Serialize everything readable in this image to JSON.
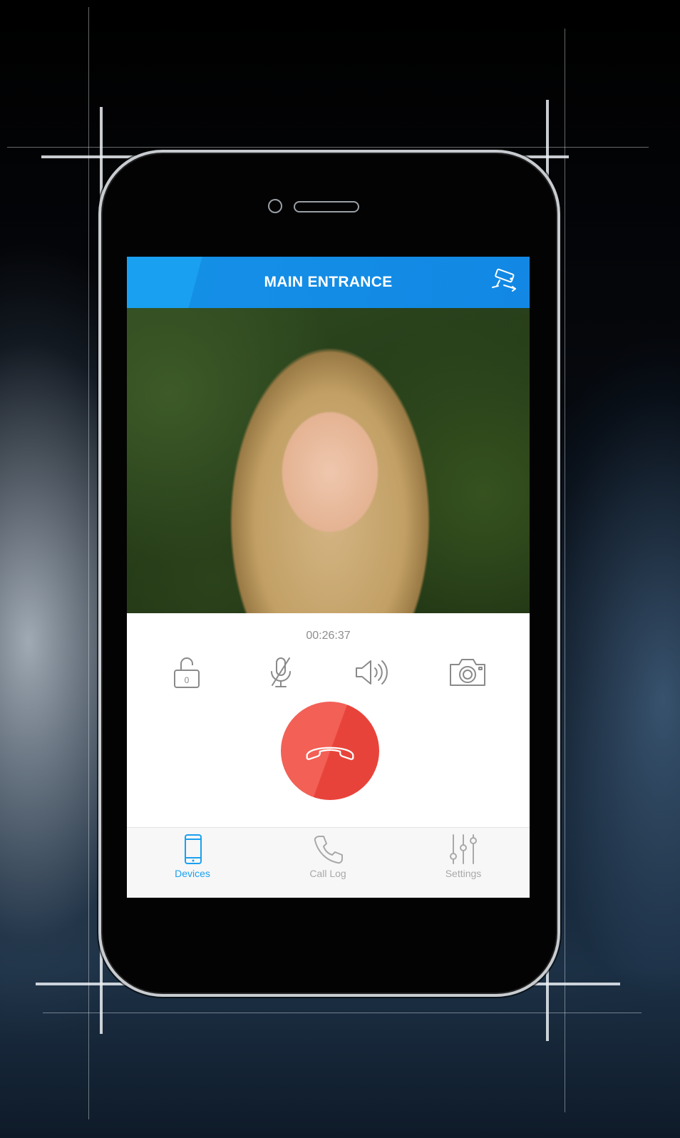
{
  "header": {
    "title": "MAIN ENTRANCE",
    "camera_icon": "cctv-camera-icon"
  },
  "call": {
    "duration": "00:26:37"
  },
  "controls": [
    {
      "name": "unlock-button",
      "icon": "padlock-open-icon",
      "lock_number": "0"
    },
    {
      "name": "mute-button",
      "icon": "microphone-muted-icon"
    },
    {
      "name": "speaker-button",
      "icon": "speaker-icon"
    },
    {
      "name": "snapshot-button",
      "icon": "camera-icon"
    }
  ],
  "hangup": {
    "icon": "phone-hangup-icon",
    "color": "#f26056"
  },
  "tabbar": {
    "tabs": [
      {
        "label": "Devices",
        "icon": "smartphone-icon",
        "active": true
      },
      {
        "label": "Call Log",
        "icon": "phone-icon",
        "active": false
      },
      {
        "label": "Settings",
        "icon": "sliders-icon",
        "active": false
      }
    ]
  },
  "colors": {
    "accent": "#1aa0f0",
    "header": "#1288e4",
    "hangup": "#e8433a",
    "inactive_tab": "#a9a9a9",
    "icon_gray": "#8a8a8a"
  }
}
